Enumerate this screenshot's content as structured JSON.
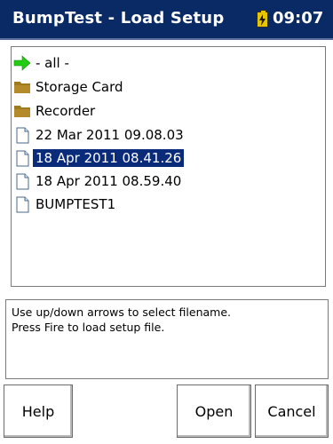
{
  "title_bar": {
    "title": "BumpTest - Load Setup",
    "time": "09:07",
    "battery_icon": "battery-charging-icon"
  },
  "file_list": {
    "items": [
      {
        "label": "- all -",
        "icon": "green-arrow-icon",
        "selected": false
      },
      {
        "label": "Storage Card",
        "icon": "folder-icon",
        "selected": false
      },
      {
        "label": "Recorder",
        "icon": "folder-icon",
        "selected": false
      },
      {
        "label": "22 Mar 2011 09.08.03",
        "icon": "document-icon",
        "selected": false
      },
      {
        "label": "18 Apr 2011 08.41.26",
        "icon": "document-icon",
        "selected": true
      },
      {
        "label": "18 Apr 2011 08.59.40",
        "icon": "document-icon",
        "selected": false
      },
      {
        "label": "BUMPTEST1",
        "icon": "document-icon",
        "selected": false
      }
    ]
  },
  "help_text": {
    "line1": "Use up/down arrows to select filename.",
    "line2": "Press Fire to load setup file."
  },
  "buttons": {
    "help": "Help",
    "open": "Open",
    "cancel": "Cancel"
  },
  "colors": {
    "title_bar": "#0a2a66",
    "selection": "#0a2a7a",
    "arrow": "#22cc11",
    "folder": "#a07a1e"
  }
}
